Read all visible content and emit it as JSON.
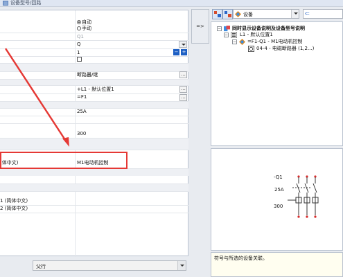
{
  "window": {
    "title": "设备型号/回路"
  },
  "grid": {
    "rows": [
      {
        "label": "",
        "value_lines": [
          "自动",
          "手动"
        ],
        "type": "radio",
        "selected": 0
      },
      {
        "label": "",
        "value": "Q1",
        "muted": true
      },
      {
        "label": "",
        "value": "Q",
        "dropdown": true
      },
      {
        "label": "",
        "value": "1",
        "stepper": true
      },
      {
        "label": "",
        "value": "",
        "checkbox": true
      },
      {
        "label": "",
        "value": "断路器/继",
        "dots": true
      },
      {
        "label": "",
        "value": "+L1 - 默认位置1",
        "dots": true
      },
      {
        "label": "",
        "value": "=F1",
        "dots": true
      },
      {
        "label": "",
        "value": "25A"
      },
      {
        "label": "",
        "value": "300"
      },
      {
        "label": "(体中文)",
        "value": "M1电动机控制"
      },
      {
        "label": "1 (简体中文)",
        "value": ""
      },
      {
        "label": "2 (简体中文)",
        "value": ""
      }
    ]
  },
  "bottom_combo": {
    "value": "父行"
  },
  "middle_button": {
    "label": "=>"
  },
  "right": {
    "combo": {
      "value": "设备"
    },
    "tree": {
      "root": "同时显示设备说明及设备型号说明",
      "location": "L1 - 默认位置1",
      "device": "=F1-Q1 - M1电动机控制",
      "part": "04-4 - 电磁断路器 (1,2...)"
    },
    "schematic": {
      "tag": "-Q1",
      "current": "25A",
      "value": "300"
    },
    "hint": "符号与所选的设备关联。"
  },
  "colors": {
    "highlight": "#e53935",
    "arrow": "#e53935"
  }
}
